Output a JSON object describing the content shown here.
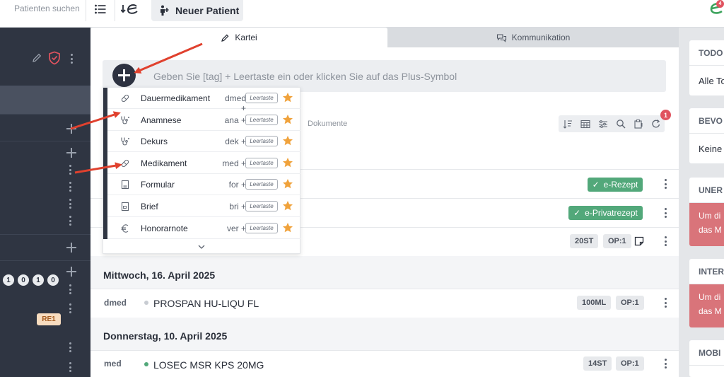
{
  "topbar": {
    "search_label": "Patienten suchen",
    "new_patient_label": "Neuer Patient",
    "notification_count": "4"
  },
  "sidebar": {
    "numbers": [
      "1",
      "0",
      "1",
      "0"
    ],
    "re_badge": "RE1"
  },
  "tabs": [
    {
      "label": "Kartei",
      "active": true
    },
    {
      "label": "Kommunikation",
      "active": false
    }
  ],
  "tag_input": {
    "placeholder": "Geben Sie [tag] + Leertaste ein oder klicken Sie auf das Plus-Symbol"
  },
  "dropdown": {
    "items": [
      {
        "label": "Dauermedikament",
        "abbr": "dmed +",
        "key": "Leertaste",
        "icon": "pill-icon"
      },
      {
        "label": "Anamnese",
        "abbr": "ana +",
        "key": "Leertaste",
        "icon": "stethoscope-icon"
      },
      {
        "label": "Dekurs",
        "abbr": "dek +",
        "key": "Leertaste",
        "icon": "stethoscope-icon"
      },
      {
        "label": "Medikament",
        "abbr": "med +",
        "key": "Leertaste",
        "icon": "pill-icon"
      },
      {
        "label": "Formular",
        "abbr": "for +",
        "key": "Leertaste",
        "icon": "form-icon"
      },
      {
        "label": "Brief",
        "abbr": "bri +",
        "key": "Leertaste",
        "icon": "letter-icon"
      },
      {
        "label": "Honorarnote",
        "abbr": "ver +",
        "key": "Leertaste",
        "icon": "euro-icon"
      }
    ],
    "star_color": "#f0a23b"
  },
  "documents": {
    "label": "Dokumente",
    "badge": "1"
  },
  "entries": {
    "erezept": "e-Rezept",
    "eprivatrezept": "e-Privatrezept",
    "row3_tags": [
      "20ST",
      "OP:1"
    ]
  },
  "days": [
    {
      "title": "Mittwoch, 16. April 2025",
      "code": "dmed",
      "name": "PROSPAN HU-LIQU FL",
      "dot_color": "#c8ccd2",
      "tags": [
        "100ML",
        "OP:1"
      ]
    },
    {
      "title": "Donnerstag, 10. April 2025",
      "code": "med",
      "name": "LOSEC MSR KPS 20MG",
      "dot_color": "#52a87a",
      "tags": [
        "14ST",
        "OP:1"
      ]
    }
  ],
  "right_panel": {
    "todo_title": "TODO",
    "todo_body": "Alle To",
    "bevo_title": "BEVO",
    "bevo_body": "Keine",
    "uner_title": "UNER",
    "uner_text1": "Um di",
    "uner_text2": "das M",
    "inter_title": "INTER",
    "inter_text1": "Um di",
    "inter_text2": "das M",
    "mobi_title": "MOBI"
  },
  "colors": {
    "sidebar": "#2f3542",
    "green": "#52a87a",
    "red_card": "#d9747a",
    "arrow": "#e0412e"
  }
}
